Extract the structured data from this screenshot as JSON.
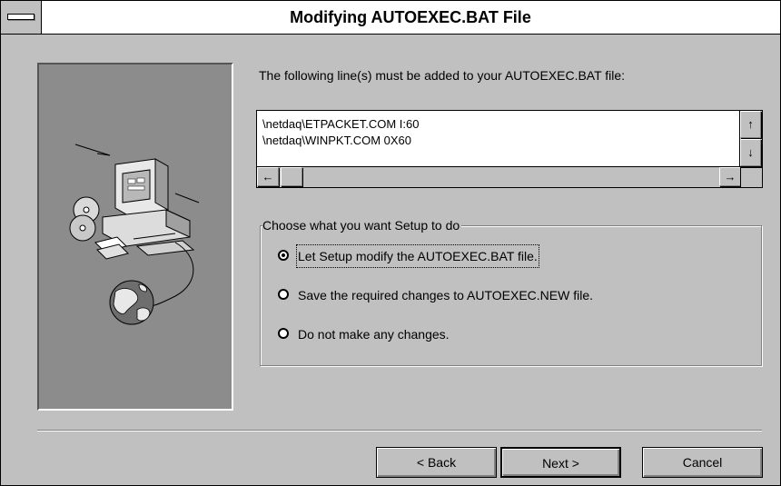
{
  "window": {
    "title": "Modifying AUTOEXEC.BAT File"
  },
  "prompt": "The following line(s) must be added to your AUTOEXEC.BAT file:",
  "lines": [
    "\\netdaq\\ETPACKET.COM I:60",
    "\\netdaq\\WINPKT.COM 0X60"
  ],
  "scroll_arrows": {
    "up": "↑",
    "down": "↓",
    "left": "←",
    "right": "→"
  },
  "group": {
    "legend": "Choose what you want Setup to do",
    "options": [
      {
        "label": "Let Setup modify the AUTOEXEC.BAT file.",
        "selected": true
      },
      {
        "label": "Save the required changes to AUTOEXEC.NEW file.",
        "selected": false
      },
      {
        "label": "Do not make any changes.",
        "selected": false
      }
    ]
  },
  "buttons": {
    "back": "< Back",
    "next": "Next >",
    "cancel": "Cancel"
  },
  "icons": [
    "system-menu-icon",
    "computer-illustration",
    "cd-disc-icon",
    "floppy-disk-icon",
    "globe-icon"
  ]
}
